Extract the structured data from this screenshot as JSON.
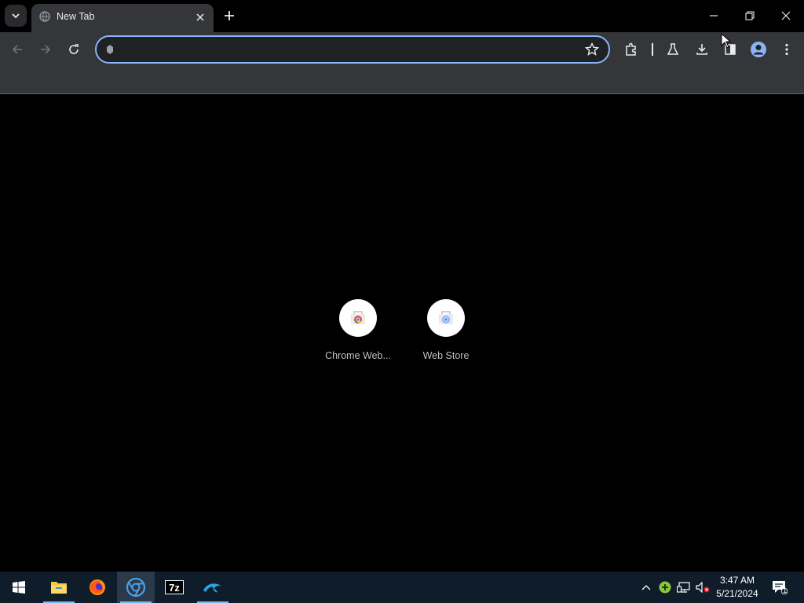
{
  "tab": {
    "title": "New Tab"
  },
  "omnibox": {
    "value": "",
    "placeholder": ""
  },
  "shortcuts": [
    {
      "label": "Chrome Web..."
    },
    {
      "label": "Web Store"
    }
  ],
  "taskbar": {
    "apps": [
      "start",
      "file-explorer",
      "firefox",
      "chrome",
      "7zip",
      "dolphin"
    ],
    "time": "3:47 AM",
    "date": "5/21/2024",
    "notification_count": "1"
  },
  "colors": {
    "accent": "#8ab4f8",
    "tab_active": "#35363a",
    "taskbar": "#0f1d2a"
  }
}
